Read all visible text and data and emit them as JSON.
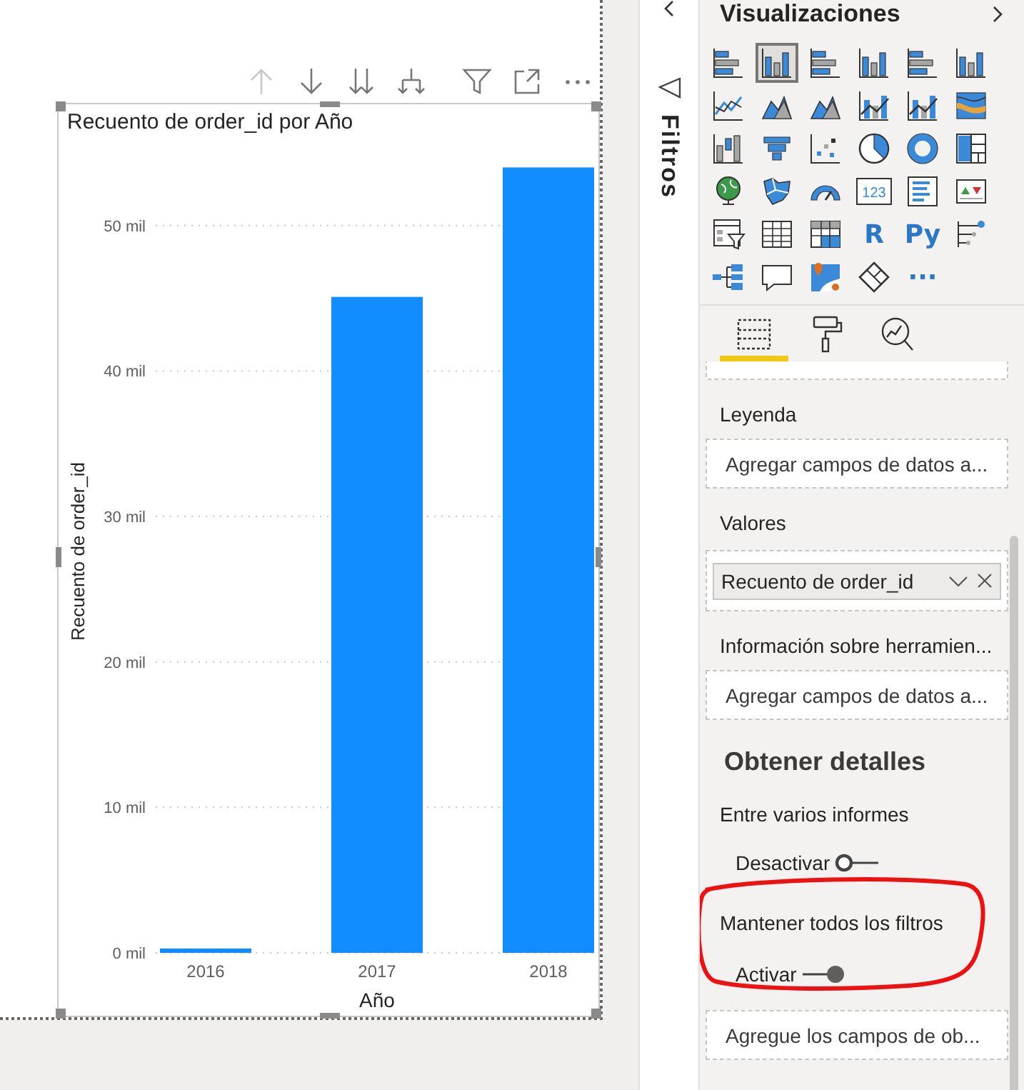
{
  "visual_toolbar": [
    {
      "kind": "drill-up",
      "disabled": true
    },
    {
      "kind": "drill-down",
      "disabled": false
    },
    {
      "kind": "next-level",
      "disabled": false
    },
    {
      "kind": "expand",
      "disabled": false
    },
    {
      "kind": "filter",
      "disabled": false
    },
    {
      "kind": "focus",
      "disabled": false
    },
    {
      "kind": "more",
      "disabled": false
    }
  ],
  "visual": {
    "chart_data": {
      "type": "bar",
      "title": "Recuento de order_id por Año",
      "xlabel": "Año",
      "ylabel": "Recuento de order_id",
      "categories": [
        "2016",
        "2017",
        "2018"
      ],
      "values": [
        0.3,
        45.1,
        54.0
      ],
      "grid": true,
      "ylim": [
        0,
        54
      ],
      "yticks": [
        {
          "value": 0,
          "label": "0 mil"
        },
        {
          "value": 10,
          "label": "10 mil"
        },
        {
          "value": 20,
          "label": "20 mil"
        },
        {
          "value": 30,
          "label": "30 mil"
        },
        {
          "value": 40,
          "label": "40 mil"
        },
        {
          "value": 50,
          "label": "50 mil"
        }
      ]
    }
  },
  "filters_pane": {
    "title": "Filtros"
  },
  "visualizations": {
    "title": "Visualizaciones",
    "types": [
      {
        "kind": "hbars",
        "selected": false
      },
      {
        "kind": "vbars",
        "selected": true
      },
      {
        "kind": "hbars",
        "selected": false
      },
      {
        "kind": "vbars",
        "selected": false
      },
      {
        "kind": "hbars",
        "selected": false
      },
      {
        "kind": "vbars",
        "selected": false
      },
      {
        "kind": "line",
        "selected": false
      },
      {
        "kind": "area",
        "selected": false
      },
      {
        "kind": "area",
        "selected": false
      },
      {
        "kind": "combo",
        "selected": false
      },
      {
        "kind": "combo",
        "selected": false
      },
      {
        "kind": "ribbon",
        "selected": false
      },
      {
        "kind": "waterfall",
        "selected": false
      },
      {
        "kind": "funnel",
        "selected": false
      },
      {
        "kind": "scatter",
        "selected": false
      },
      {
        "kind": "pie",
        "selected": false
      },
      {
        "kind": "donut",
        "selected": false
      },
      {
        "kind": "treemap",
        "selected": false
      },
      {
        "kind": "globe",
        "selected": false
      },
      {
        "kind": "map",
        "selected": false
      },
      {
        "kind": "gauge",
        "selected": false
      },
      {
        "kind": "card",
        "label": "123",
        "selected": false
      },
      {
        "kind": "list",
        "selected": false
      },
      {
        "kind": "kpi",
        "selected": false
      },
      {
        "kind": "slicer",
        "selected": false
      },
      {
        "kind": "table",
        "selected": false
      },
      {
        "kind": "matrix",
        "selected": false
      },
      {
        "kind": "text",
        "label": "R",
        "selected": false
      },
      {
        "kind": "text",
        "label": "Py",
        "selected": false
      },
      {
        "kind": "influencers",
        "selected": false
      },
      {
        "kind": "tree",
        "selected": false
      },
      {
        "kind": "bubble",
        "selected": false
      },
      {
        "kind": "pinmap",
        "selected": false
      },
      {
        "kind": "diamond",
        "selected": false
      },
      {
        "kind": "text",
        "label": "···",
        "selected": false
      }
    ],
    "tabs": [
      {
        "kind": "fields",
        "selected": true
      },
      {
        "kind": "format",
        "selected": false
      },
      {
        "kind": "analytics",
        "selected": false
      }
    ]
  },
  "field_wells": [
    {
      "kind": "label",
      "text": "Leyenda"
    },
    {
      "kind": "well",
      "placeholder": "Agregar campos de datos a..."
    },
    {
      "kind": "label",
      "text": "Valores"
    },
    {
      "kind": "chip",
      "text": "Recuento de order_id"
    },
    {
      "kind": "label",
      "text": "Información sobre herramien..."
    },
    {
      "kind": "well",
      "placeholder": "Agregar campos de datos a..."
    },
    {
      "kind": "heading",
      "text": "Obtener detalles"
    },
    {
      "kind": "label",
      "text": "Entre varios informes"
    },
    {
      "kind": "toggle",
      "label": "Desactivar",
      "on": false
    },
    {
      "kind": "group",
      "highlighted": true,
      "items": [
        {
          "kind": "label",
          "text": "Mantener todos los filtros"
        },
        {
          "kind": "toggle",
          "label": "Activar",
          "on": true
        }
      ]
    },
    {
      "kind": "well",
      "placeholder": "Agregue los campos de ob..."
    }
  ]
}
